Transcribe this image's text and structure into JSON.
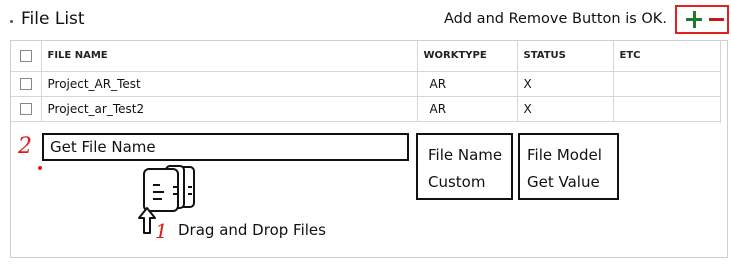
{
  "header": {
    "title": "File List",
    "note": "Add and Remove Button is OK."
  },
  "buttons": {
    "add_icon": "plus-icon",
    "remove_icon": "minus-icon",
    "accent_add": "#1f7a2e",
    "accent_remove": "#c71818",
    "highlight": "#e52020"
  },
  "table": {
    "columns": [
      "FILE NAME",
      "WORKTYPE",
      "STATUS",
      "ETC"
    ],
    "rows": [
      {
        "file_name": "Project_AR_Test",
        "worktype": "AR",
        "status": "X",
        "etc": ""
      },
      {
        "file_name": "Project_ar_Test2",
        "worktype": "AR",
        "status": "X",
        "etc": ""
      }
    ]
  },
  "annotations": {
    "step2": "2",
    "step1": "1",
    "get_file_name": "Get File Name",
    "custom_line1": "File Name",
    "custom_line2": "Custom",
    "model_line1": "File Model",
    "model_line2": "Get Value",
    "drag_drop": "Drag and Drop Files",
    "drop_icon": "files-stack-icon",
    "arrow_icon": "arrow-up-icon"
  }
}
